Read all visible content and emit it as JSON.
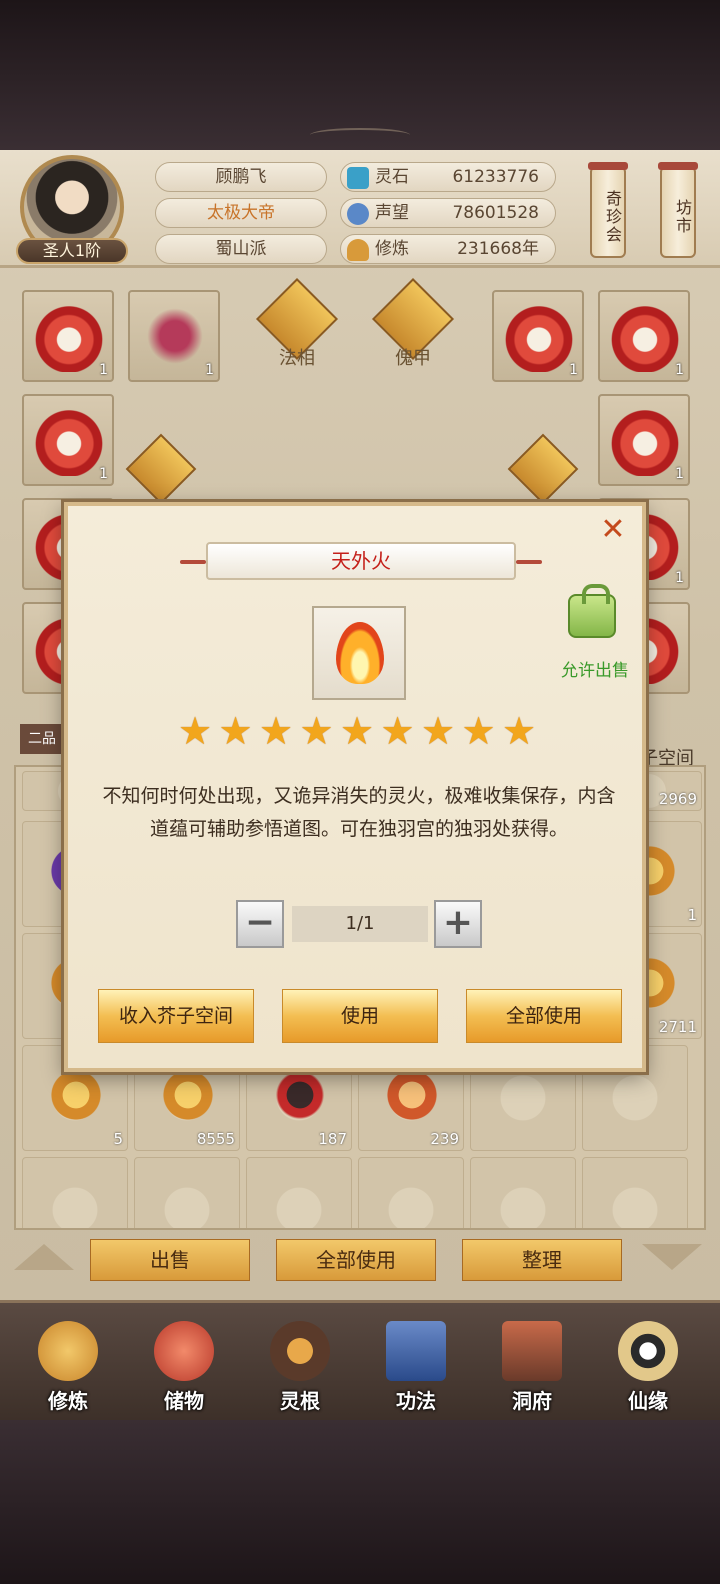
{
  "player": {
    "name": "顾鹏飞",
    "title": "太极大帝",
    "sect": "蜀山派",
    "rank": "圣人1阶"
  },
  "stats": [
    {
      "label": "灵石",
      "value": "61233776",
      "icon": "spirit-stone-icon",
      "color": "#3aa0c8"
    },
    {
      "label": "声望",
      "value": "78601528",
      "icon": "reputation-icon",
      "color": "#5a88c8"
    },
    {
      "label": "修炼",
      "value": "231668年",
      "icon": "cultivation-icon",
      "color": "#d89a3a"
    }
  ],
  "side_buttons": [
    "奇珍会",
    "坊市"
  ],
  "equip": {
    "labels": [
      "法相",
      "傀甲"
    ],
    "slot_qty": [
      "1",
      "1",
      "1",
      "1",
      "1",
      "1",
      "1",
      "1"
    ],
    "bag_tab": "二品",
    "storage_label": "子空间"
  },
  "bag": {
    "row_qty": [
      "2969",
      "1",
      "2711"
    ],
    "bottom_qty": [
      "5",
      "8555",
      "187",
      "239"
    ]
  },
  "actions": [
    "出售",
    "全部使用",
    "整理"
  ],
  "nav": [
    "修炼",
    "储物",
    "灵根",
    "功法",
    "洞府",
    "仙缘"
  ],
  "modal": {
    "title": "天外火",
    "close": "✕",
    "sell_label": "允许出售",
    "stars": 9,
    "description": "不知何时何处出现，又诡异消失的灵火，极难收集保存，内含道蕴可辅助参悟道图。可在独羽宫的独羽处获得。",
    "minus": "−",
    "plus": "+",
    "quantity": "1/1",
    "buttons": [
      "收入芥子空间",
      "使用",
      "全部使用"
    ]
  }
}
